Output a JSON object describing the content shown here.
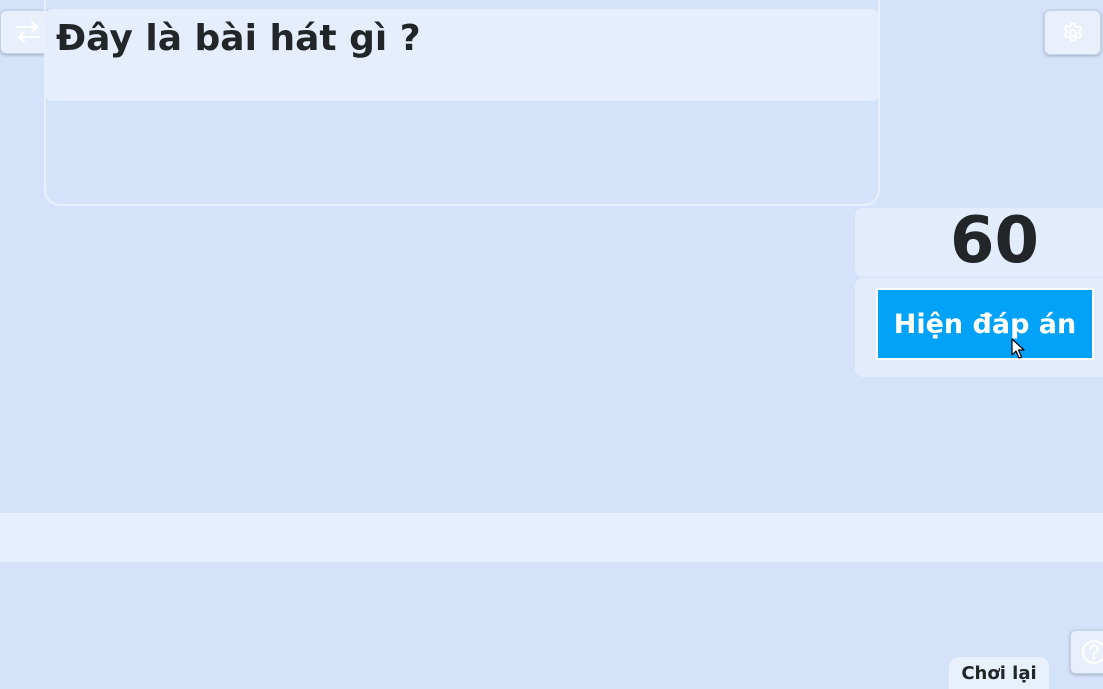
{
  "top_bar": {
    "swap_icon": "swap-arrows-icon",
    "settings_icon": "gear-icon"
  },
  "question": {
    "text": "Đây là bài hát gì ?"
  },
  "timer": {
    "value": "60"
  },
  "answer": {
    "button_label": "Hiện đáp án"
  },
  "footer": {
    "replay_label": "Chơi lại",
    "help_icon": "question-circle-icon"
  },
  "colors": {
    "background": "#d4e3fa",
    "panel": "#e3ecfc",
    "accent": "#02a2f9",
    "text": "#222628"
  }
}
